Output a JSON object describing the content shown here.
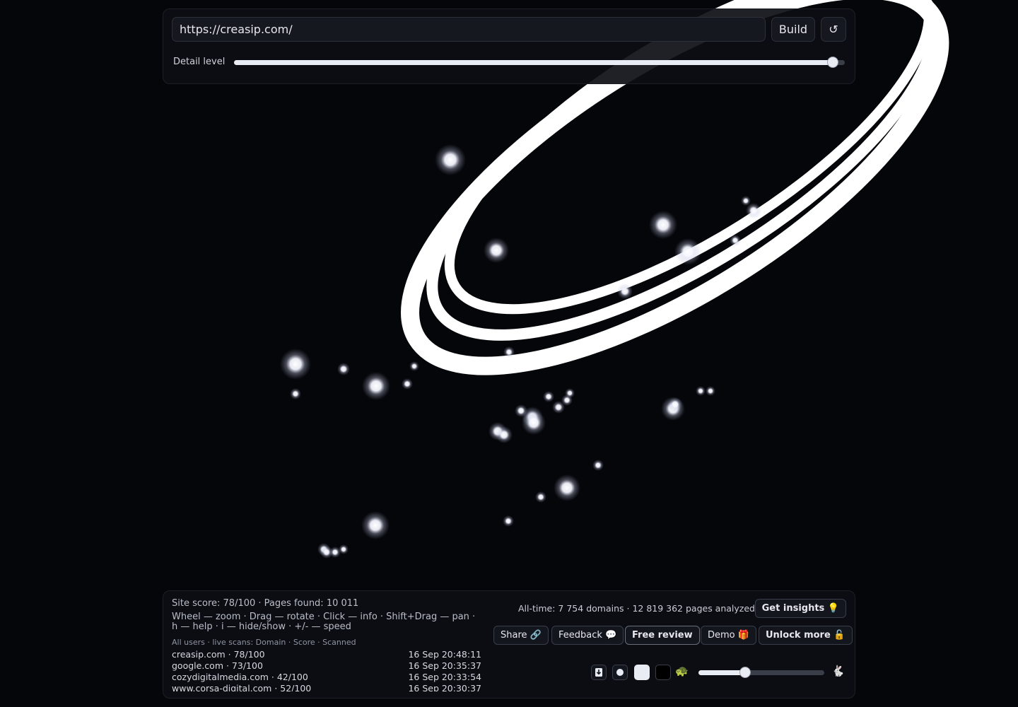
{
  "header": {
    "url_value": "https://creasip.com/",
    "build_label": "Build",
    "reset_label": "↺",
    "detail_label": "Detail level",
    "detail_value": 0.98
  },
  "footer": {
    "site_score": "Site score: 78/100 · Pages found: 10 011",
    "controls_help": "Wheel — zoom · Drag — rotate · Click — info · Shift+Drag — pan · h — help · i — hide/show · +/- — speed",
    "live_header": "All users · live scans: Domain · Score · Scanned",
    "scans": [
      {
        "domain": "creasip.com · 78/100",
        "time": "16 Sep 20:48:11"
      },
      {
        "domain": "google.com · 73/100",
        "time": "16 Sep 20:35:37"
      },
      {
        "domain": "cozydigitalmedia.com · 42/100",
        "time": "16 Sep 20:33:54"
      },
      {
        "domain": "www.corsa-digital.com · 52/100",
        "time": "16 Sep 20:30:37"
      }
    ],
    "alltime": "All-time: 7 754 domains · 12 819 362 pages analyzed",
    "insights_label": "Get insights 💡",
    "share_label": "Share 🔗",
    "feedback_label": "Feedback 💬",
    "review_label": "Free review",
    "demo_label": "Demo 🎁",
    "unlock_label": "Unlock more 🔓",
    "speed_value": 0.37,
    "icons": {
      "download": "download-icon",
      "dot": "dot-theme-icon",
      "light": "light-theme-icon",
      "dark": "dark-theme-icon",
      "turtle": "🐢",
      "rabbit": "🐇"
    }
  }
}
